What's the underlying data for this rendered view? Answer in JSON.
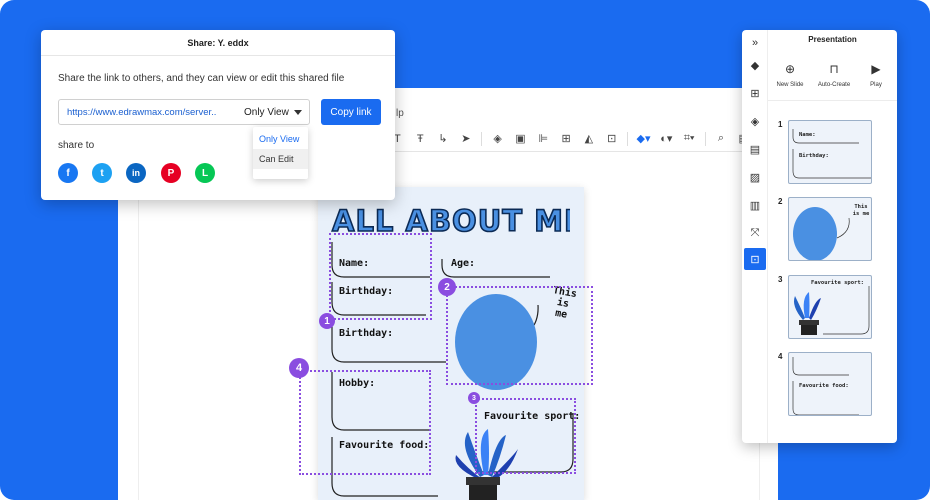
{
  "share_dialog": {
    "title": "Share: Y. eddx",
    "description": "Share the link to others, and they can view or edit this shared file",
    "link_url": "https://www.edrawmax.com/server..",
    "permission": "Only View",
    "copy_button": "Copy link",
    "share_to_label": "share to",
    "permission_options": [
      "Only View",
      "Can Edit"
    ],
    "social": [
      {
        "name": "facebook",
        "glyph": "f",
        "color": "#1877f2"
      },
      {
        "name": "twitter",
        "glyph": "t",
        "color": "#1da1f2"
      },
      {
        "name": "linkedin",
        "glyph": "in",
        "color": "#0a66c2"
      },
      {
        "name": "pinterest",
        "glyph": "P",
        "color": "#e60023"
      },
      {
        "name": "line",
        "glyph": "L",
        "color": "#06c755"
      }
    ]
  },
  "editor": {
    "help_menu_fragment": "lp"
  },
  "poster": {
    "title": "ALL ABOUT ME",
    "labels": {
      "name": "Name:",
      "age": "Age:",
      "birthday_1": "Birthday:",
      "birthday_2": "Birthday:",
      "hobby": "Hobby:",
      "favourite_sport": "Favourite sport:",
      "favourite_food": "Favourite food:",
      "speech": "This is me"
    },
    "badges": [
      "1",
      "2",
      "3",
      "4"
    ],
    "accent": "#8a4de0",
    "avatar_color": "#4a90e2"
  },
  "presentation": {
    "title": "Presentation",
    "tools": [
      {
        "label": "New Slide",
        "icon": "plus-circle-icon"
      },
      {
        "label": "Auto-Create",
        "icon": "presentation-board-icon"
      },
      {
        "label": "Play",
        "icon": "play-icon"
      }
    ],
    "slides": [
      {
        "number": "1",
        "lines": [
          "Name:",
          "Birthday:"
        ]
      },
      {
        "number": "2",
        "lines": [
          "This is me"
        ]
      },
      {
        "number": "3",
        "lines": [
          "Favourite sport:"
        ]
      },
      {
        "number": "4",
        "lines": [
          "Favourite food:"
        ]
      }
    ]
  }
}
